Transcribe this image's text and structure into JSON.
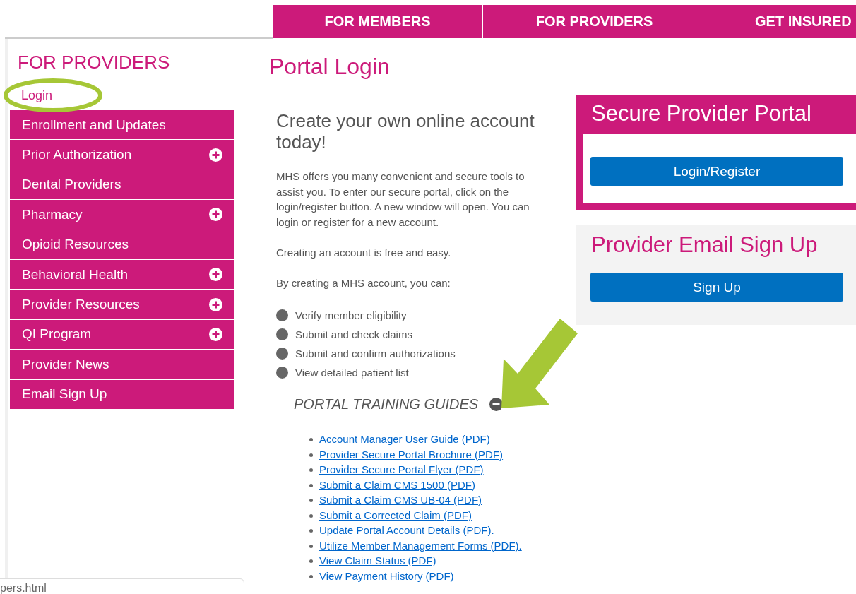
{
  "top_nav": [
    {
      "label": "FOR MEMBERS"
    },
    {
      "label": "FOR PROVIDERS"
    },
    {
      "label": "GET INSURED"
    }
  ],
  "sidebar": {
    "heading": "FOR PROVIDERS",
    "items": [
      {
        "label": "Login",
        "kind": "link"
      },
      {
        "label": "Enrollment and Updates",
        "kind": "menu",
        "expandable": false
      },
      {
        "label": "Prior Authorization",
        "kind": "menu",
        "expandable": true
      },
      {
        "label": "Dental Providers",
        "kind": "menu",
        "expandable": false
      },
      {
        "label": "Pharmacy",
        "kind": "menu",
        "expandable": true
      },
      {
        "label": "Opioid Resources",
        "kind": "menu",
        "expandable": false
      },
      {
        "label": "Behavioral Health",
        "kind": "menu",
        "expandable": true
      },
      {
        "label": "Provider Resources",
        "kind": "menu",
        "expandable": true
      },
      {
        "label": "QI Program",
        "kind": "menu",
        "expandable": true
      },
      {
        "label": "Provider News",
        "kind": "menu",
        "expandable": false
      },
      {
        "label": "Email Sign Up",
        "kind": "menu",
        "expandable": false
      }
    ]
  },
  "main": {
    "title": "Portal Login",
    "heading": "Create your own online account today!",
    "paragraphs": [
      "MHS offers you many convenient and secure tools to assist you. To enter our secure portal, click on the login/register button. A new window will open. You can login or register for a new account.",
      "Creating an account is free and easy.",
      "By creating a MHS account, you can:"
    ],
    "features": [
      "Verify member eligibility",
      "Submit and check claims",
      "Submit and confirm authorizations",
      "View detailed patient list"
    ],
    "guides": {
      "title": "PORTAL TRAINING GUIDES",
      "expanded": true,
      "links": [
        "Account Manager User Guide (PDF)",
        "Provider Secure Portal Brochure (PDF)",
        "Provider Secure Portal Flyer (PDF)",
        "Submit a Claim CMS 1500 (PDF)",
        "Submit a Claim CMS UB-04 (PDF)",
        "Submit a Corrected Claim (PDF)",
        "Update Portal Account Details (PDF).",
        "Utilize Member Management Forms (PDF).",
        "View Claim Status (PDF)",
        "View Payment History (PDF)"
      ]
    }
  },
  "panels": [
    {
      "kind": "portal",
      "title": "Secure Provider Portal",
      "button": "Login/Register"
    },
    {
      "kind": "signup",
      "title": "Provider Email Sign Up",
      "button": "Sign Up"
    }
  ],
  "status_url": "pers.html"
}
